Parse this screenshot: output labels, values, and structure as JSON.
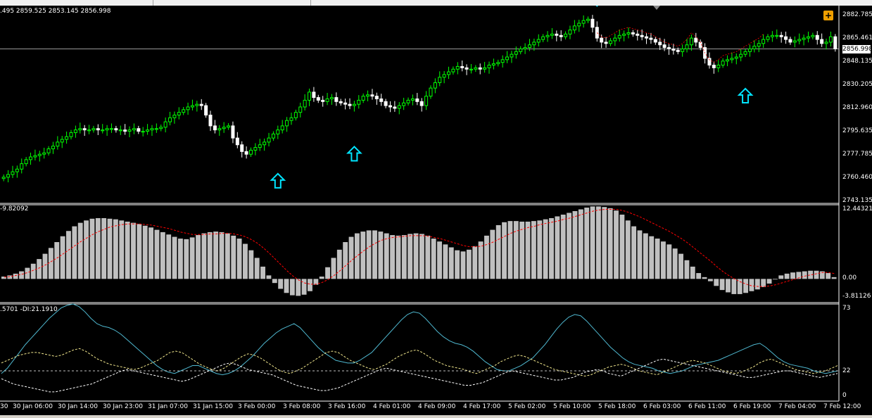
{
  "window": {
    "ohlc_text": ".495 2859.525 2853.145 2856.998",
    "macd_text": "-9.82092",
    "adx_text": ".5701 -DI:21.1910",
    "current_price": "2856.998",
    "plus_label": "+"
  },
  "price_axis": [
    "2882.785",
    "2865.461",
    "2848.135",
    "2830.205",
    "2812.960",
    "2795.635",
    "2777.785",
    "2760.460",
    "2743.135"
  ],
  "macd_axis": [
    "12.44321",
    "0.00",
    "-3.81126"
  ],
  "adx_axis": [
    "73",
    "22",
    "0"
  ],
  "time_axis": [
    "30",
    "30 Jan 06:00",
    "30 Jan 14:00",
    "30 Jan 23:00",
    "31 Jan 07:00",
    "31 Jan 15:00",
    "3 Feb 00:00",
    "3 Feb 08:00",
    "3 Feb 16:00",
    "4 Feb 01:00",
    "4 Feb 09:00",
    "4 Feb 17:00",
    "5 Feb 02:00",
    "5 Feb 10:00",
    "5 Feb 18:00",
    "6 Feb 03:00",
    "6 Feb 11:00",
    "6 Feb 19:00",
    "7 Feb 04:00",
    "7 Feb 12:00"
  ],
  "colors": {
    "background": "#000000",
    "bull_candle": "#00ff00",
    "bear_candle": "#ffffff",
    "histogram": "#c0c0c0",
    "signal": "#ff0000",
    "adx": "#4fb8d0",
    "plus_di": "#f0e68c",
    "minus_di": "#ffffff",
    "arrow": "#00e5ff",
    "level_line": "#ffffff"
  },
  "chart_data": [
    {
      "type": "candlestick",
      "title": "",
      "ylim": [
        2743.135,
        2888.0
      ],
      "current_price": 2856.998,
      "close": [
        2762,
        2764,
        2766,
        2768,
        2772,
        2775,
        2777,
        2778,
        2779,
        2780,
        2783,
        2785,
        2788,
        2790,
        2792,
        2795,
        2797,
        2798,
        2797,
        2797,
        2798,
        2797,
        2797,
        2798,
        2798,
        2797,
        2797,
        2796,
        2797,
        2798,
        2796,
        2796,
        2797,
        2798,
        2798,
        2799,
        2803,
        2806,
        2808,
        2810,
        2812,
        2814,
        2815,
        2816,
        2815,
        2808,
        2800,
        2797,
        2798,
        2799,
        2800,
        2791,
        2786,
        2781,
        2779,
        2782,
        2784,
        2786,
        2788,
        2791,
        2794,
        2797,
        2800,
        2804,
        2806,
        2810,
        2814,
        2819,
        2825,
        2821,
        2819,
        2818,
        2820,
        2821,
        2818,
        2817,
        2816,
        2815,
        2816,
        2819,
        2822,
        2823,
        2822,
        2820,
        2818,
        2815,
        2814,
        2813,
        2815,
        2817,
        2819,
        2820,
        2818,
        2815,
        2822,
        2828,
        2832,
        2836,
        2838,
        2840,
        2842,
        2844,
        2843,
        2842,
        2842,
        2843,
        2842,
        2843,
        2845,
        2846,
        2847,
        2849,
        2851,
        2853,
        2855,
        2857,
        2858,
        2860,
        2862,
        2864,
        2866,
        2867,
        2868,
        2867,
        2866,
        2868,
        2871,
        2874,
        2876,
        2878,
        2879,
        2873,
        2865,
        2862,
        2861,
        2863,
        2865,
        2867,
        2868,
        2869,
        2868,
        2867,
        2866,
        2865,
        2864,
        2862,
        2860,
        2858,
        2857,
        2856,
        2855,
        2857,
        2860,
        2865,
        2862,
        2858,
        2850,
        2845,
        2843,
        2845,
        2848,
        2849,
        2850,
        2851,
        2853,
        2855,
        2857,
        2859,
        2861,
        2864,
        2866,
        2867,
        2867,
        2866,
        2864,
        2862,
        2863,
        2864,
        2865,
        2866,
        2867,
        2864,
        2861,
        2862,
        2866,
        2857
      ],
      "markers": [
        {
          "type": "up-arrow",
          "price": 2775,
          "index": 61
        },
        {
          "type": "up-arrow",
          "price": 2795,
          "index": 78
        },
        {
          "type": "down-arrow",
          "price": 2880,
          "index": 132
        },
        {
          "type": "up-arrow",
          "price": 2838,
          "index": 165
        }
      ]
    },
    {
      "type": "bar",
      "title": "MACD",
      "ylim": [
        -3.81126,
        12.44321
      ],
      "histogram": [
        0.4,
        0.6,
        0.9,
        1.3,
        1.9,
        2.6,
        3.4,
        4.3,
        5.3,
        6.3,
        7.3,
        8.2,
        9.0,
        9.6,
        10.0,
        10.3,
        10.4,
        10.4,
        10.3,
        10.2,
        10.0,
        9.8,
        9.6,
        9.4,
        9.1,
        8.8,
        8.4,
        8.0,
        7.6,
        7.2,
        6.9,
        6.8,
        7.1,
        7.5,
        7.8,
        8.0,
        8.1,
        8.0,
        7.8,
        7.4,
        6.9,
        6.0,
        4.9,
        3.6,
        2.1,
        0.6,
        -0.7,
        -1.7,
        -2.4,
        -2.8,
        -2.9,
        -2.7,
        -2.1,
        -1.0,
        0.4,
        2.0,
        3.6,
        5.0,
        6.3,
        7.2,
        7.8,
        8.1,
        8.3,
        8.3,
        8.1,
        7.8,
        7.5,
        7.4,
        7.5,
        7.7,
        7.8,
        7.7,
        7.4,
        6.9,
        6.4,
        5.9,
        5.4,
        4.9,
        4.7,
        5.0,
        5.6,
        6.4,
        7.4,
        8.4,
        9.2,
        9.7,
        9.9,
        9.9,
        9.8,
        9.8,
        9.9,
        10.0,
        10.2,
        10.4,
        10.7,
        11.0,
        11.3,
        11.6,
        11.9,
        12.2,
        12.4,
        12.4,
        12.3,
        12.1,
        11.7,
        11.0,
        10.0,
        9.0,
        8.3,
        7.8,
        7.3,
        6.9,
        6.4,
        5.9,
        5.2,
        4.3,
        3.2,
        2.1,
        1.0,
        0.3,
        -0.4,
        -1.2,
        -1.9,
        -2.3,
        -2.6,
        -2.6,
        -2.4,
        -2.1,
        -1.8,
        -1.4,
        -0.8,
        -0.1,
        0.6,
        0.9,
        1.1,
        1.2,
        1.3,
        1.4,
        1.4,
        1.3,
        1.0,
        0.3
      ],
      "signal": [
        0.3,
        0.4,
        0.6,
        0.8,
        1.1,
        1.5,
        1.9,
        2.4,
        3.0,
        3.6,
        4.3,
        5.0,
        5.7,
        6.4,
        7.0,
        7.6,
        8.1,
        8.5,
        8.9,
        9.1,
        9.3,
        9.4,
        9.4,
        9.4,
        9.3,
        9.2,
        9.0,
        8.8,
        8.6,
        8.3,
        8.0,
        7.8,
        7.6,
        7.6,
        7.6,
        7.7,
        7.7,
        7.8,
        7.8,
        7.7,
        7.5,
        7.2,
        6.7,
        6.1,
        5.3,
        4.4,
        3.4,
        2.4,
        1.4,
        0.5,
        -0.2,
        -0.7,
        -0.9,
        -0.9,
        -0.6,
        -0.1,
        0.6,
        1.4,
        2.3,
        3.2,
        4.0,
        4.8,
        5.5,
        6.1,
        6.6,
        6.9,
        7.1,
        7.2,
        7.3,
        7.4,
        7.4,
        7.4,
        7.3,
        7.1,
        6.9,
        6.6,
        6.3,
        6.0,
        5.7,
        5.5,
        5.5,
        5.6,
        5.9,
        6.3,
        6.8,
        7.3,
        7.8,
        8.2,
        8.5,
        8.8,
        9.0,
        9.3,
        9.5,
        9.7,
        9.9,
        10.2,
        10.4,
        10.7,
        11.0,
        11.3,
        11.6,
        11.8,
        11.9,
        11.9,
        11.9,
        11.7,
        11.4,
        11.0,
        10.6,
        10.1,
        9.6,
        9.1,
        8.6,
        8.1,
        7.5,
        6.9,
        6.2,
        5.4,
        4.6,
        3.8,
        3.0,
        2.1,
        1.3,
        0.6,
        0.0,
        -0.5,
        -0.9,
        -1.2,
        -1.3,
        -1.3,
        -1.2,
        -1.0,
        -0.7,
        -0.4,
        -0.1,
        0.2,
        0.5,
        0.7,
        0.9,
        1.1,
        1.1,
        0.9
      ]
    },
    {
      "type": "line",
      "title": "ADX",
      "ylim": [
        0,
        73
      ],
      "series": [
        {
          "key": "adx",
          "values": [
            20,
            24,
            30,
            36,
            42,
            47,
            52,
            57,
            62,
            66,
            70,
            72,
            73,
            71,
            67,
            62,
            58,
            56,
            55,
            53,
            50,
            46,
            42,
            38,
            34,
            30,
            26,
            23,
            21,
            20,
            22,
            24,
            26,
            26,
            24,
            22,
            20,
            19,
            20,
            22,
            25,
            29,
            33,
            38,
            43,
            47,
            51,
            54,
            56,
            58,
            55,
            50,
            45,
            40,
            36,
            33,
            30,
            29,
            28,
            28,
            30,
            33,
            36,
            41,
            46,
            51,
            56,
            61,
            65,
            67,
            66,
            62,
            57,
            52,
            48,
            45,
            43,
            42,
            40,
            37,
            33,
            29,
            26,
            23,
            22,
            22,
            24,
            26,
            29,
            32,
            37,
            42,
            48,
            54,
            59,
            63,
            65,
            64,
            60,
            55,
            50,
            45,
            40,
            36,
            32,
            29,
            27,
            26,
            25,
            24,
            22,
            21,
            20,
            21,
            22,
            24,
            26,
            27,
            28,
            29,
            30,
            32,
            34,
            36,
            38,
            40,
            42,
            43,
            40,
            36,
            32,
            29,
            27,
            26,
            25,
            24,
            22,
            21,
            20,
            21,
            22
          ]
        },
        {
          "key": "plus_di",
          "values": [
            28,
            30,
            32,
            34,
            35,
            36,
            36,
            35,
            34,
            33,
            34,
            36,
            38,
            39,
            37,
            34,
            31,
            29,
            27,
            26,
            25,
            24,
            23,
            24,
            26,
            28,
            30,
            33,
            36,
            37,
            36,
            33,
            30,
            27,
            25,
            23,
            22,
            24,
            27,
            30,
            33,
            35,
            34,
            32,
            29,
            26,
            23,
            21,
            20,
            22,
            24,
            27,
            30,
            33,
            36,
            37,
            36,
            33,
            30,
            28,
            26,
            24,
            23,
            25,
            27,
            30,
            33,
            35,
            37,
            38,
            36,
            33,
            30,
            28,
            26,
            25,
            24,
            23,
            21,
            20,
            22,
            24,
            26,
            29,
            31,
            33,
            34,
            33,
            31,
            29,
            27,
            25,
            23,
            22,
            21,
            20,
            19,
            18,
            19,
            21,
            23,
            25,
            26,
            27,
            26,
            24,
            22,
            21,
            20,
            19,
            21,
            23,
            25,
            27,
            29,
            30,
            29,
            28,
            26,
            24,
            22,
            21,
            20,
            21,
            23,
            25,
            28,
            30,
            31,
            29,
            27,
            25,
            23,
            22,
            21,
            20,
            21,
            22,
            24,
            26
          ]
        },
        {
          "key": "minus_di",
          "values": [
            16,
            14,
            12,
            11,
            10,
            9,
            8,
            7,
            6,
            6,
            7,
            8,
            9,
            10,
            11,
            12,
            14,
            16,
            18,
            20,
            22,
            23,
            22,
            21,
            20,
            19,
            18,
            17,
            16,
            15,
            14,
            15,
            17,
            19,
            21,
            23,
            25,
            27,
            28,
            27,
            25,
            23,
            22,
            21,
            20,
            19,
            17,
            15,
            13,
            11,
            10,
            9,
            8,
            7,
            7,
            8,
            9,
            11,
            13,
            15,
            17,
            19,
            21,
            23,
            24,
            23,
            22,
            21,
            20,
            19,
            18,
            17,
            16,
            15,
            14,
            13,
            12,
            11,
            11,
            12,
            13,
            15,
            17,
            19,
            21,
            22,
            21,
            20,
            19,
            18,
            17,
            16,
            15,
            15,
            16,
            17,
            19,
            21,
            22,
            23,
            22,
            20,
            19,
            18,
            20,
            22,
            24,
            26,
            28,
            30,
            31,
            30,
            29,
            28,
            27,
            26,
            25,
            24,
            23,
            22,
            21,
            20,
            19,
            18,
            17,
            17,
            18,
            19,
            20,
            21,
            22,
            22,
            21,
            20,
            19,
            18,
            17,
            18,
            19,
            20
          ]
        },
        {
          "key": "level",
          "values": [
            22
          ]
        }
      ]
    }
  ]
}
